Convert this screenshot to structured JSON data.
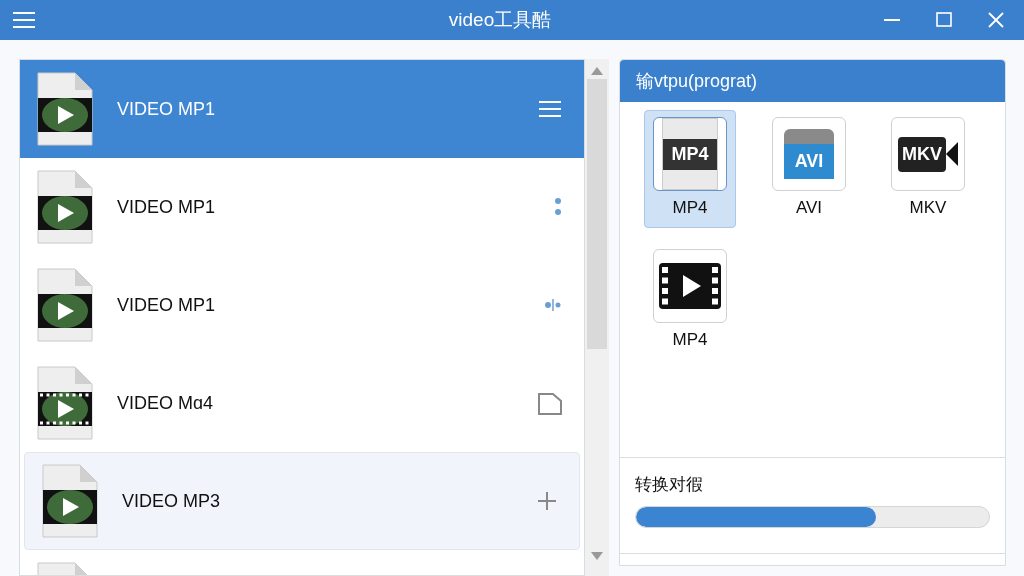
{
  "window": {
    "title": "video工具酷"
  },
  "files": [
    {
      "name": "VIDEO MP1",
      "thumb": {
        "kind": "plain"
      },
      "action": {
        "kind": "menu"
      },
      "selected": true,
      "hovered": false
    },
    {
      "name": "VIDEO MP1",
      "thumb": {
        "kind": "plain"
      },
      "action": {
        "kind": "dots"
      },
      "selected": false,
      "hovered": false
    },
    {
      "name": "VIDEO MP1",
      "thumb": {
        "kind": "plain"
      },
      "action": {
        "kind": "split"
      },
      "selected": false,
      "hovered": false
    },
    {
      "name": "VIDEO Mɑ4",
      "thumb": {
        "kind": "film"
      },
      "action": {
        "kind": "doc"
      },
      "selected": false,
      "hovered": false
    },
    {
      "name": "VIDEO MP3",
      "thumb": {
        "kind": "plain"
      },
      "action": {
        "kind": "plus"
      },
      "selected": false,
      "hovered": true
    },
    {
      "thumb": {
        "kind": "plain"
      },
      "selected": false,
      "hovered": false
    }
  ],
  "output_panel": {
    "title": "输vtpu(prograt)",
    "formats": [
      {
        "label": "MP4",
        "badge": "MP4",
        "kind": "doc",
        "selected": true
      },
      {
        "label": "AVI",
        "badge": "AVI",
        "kind": "avi",
        "selected": false
      },
      {
        "label": "MKV",
        "badge": "MKV",
        "kind": "camera",
        "selected": false
      },
      {
        "label": "MP4",
        "kind": "film",
        "selected": false
      }
    ]
  },
  "progress": {
    "label": "转换对徦",
    "level": 0.68
  }
}
